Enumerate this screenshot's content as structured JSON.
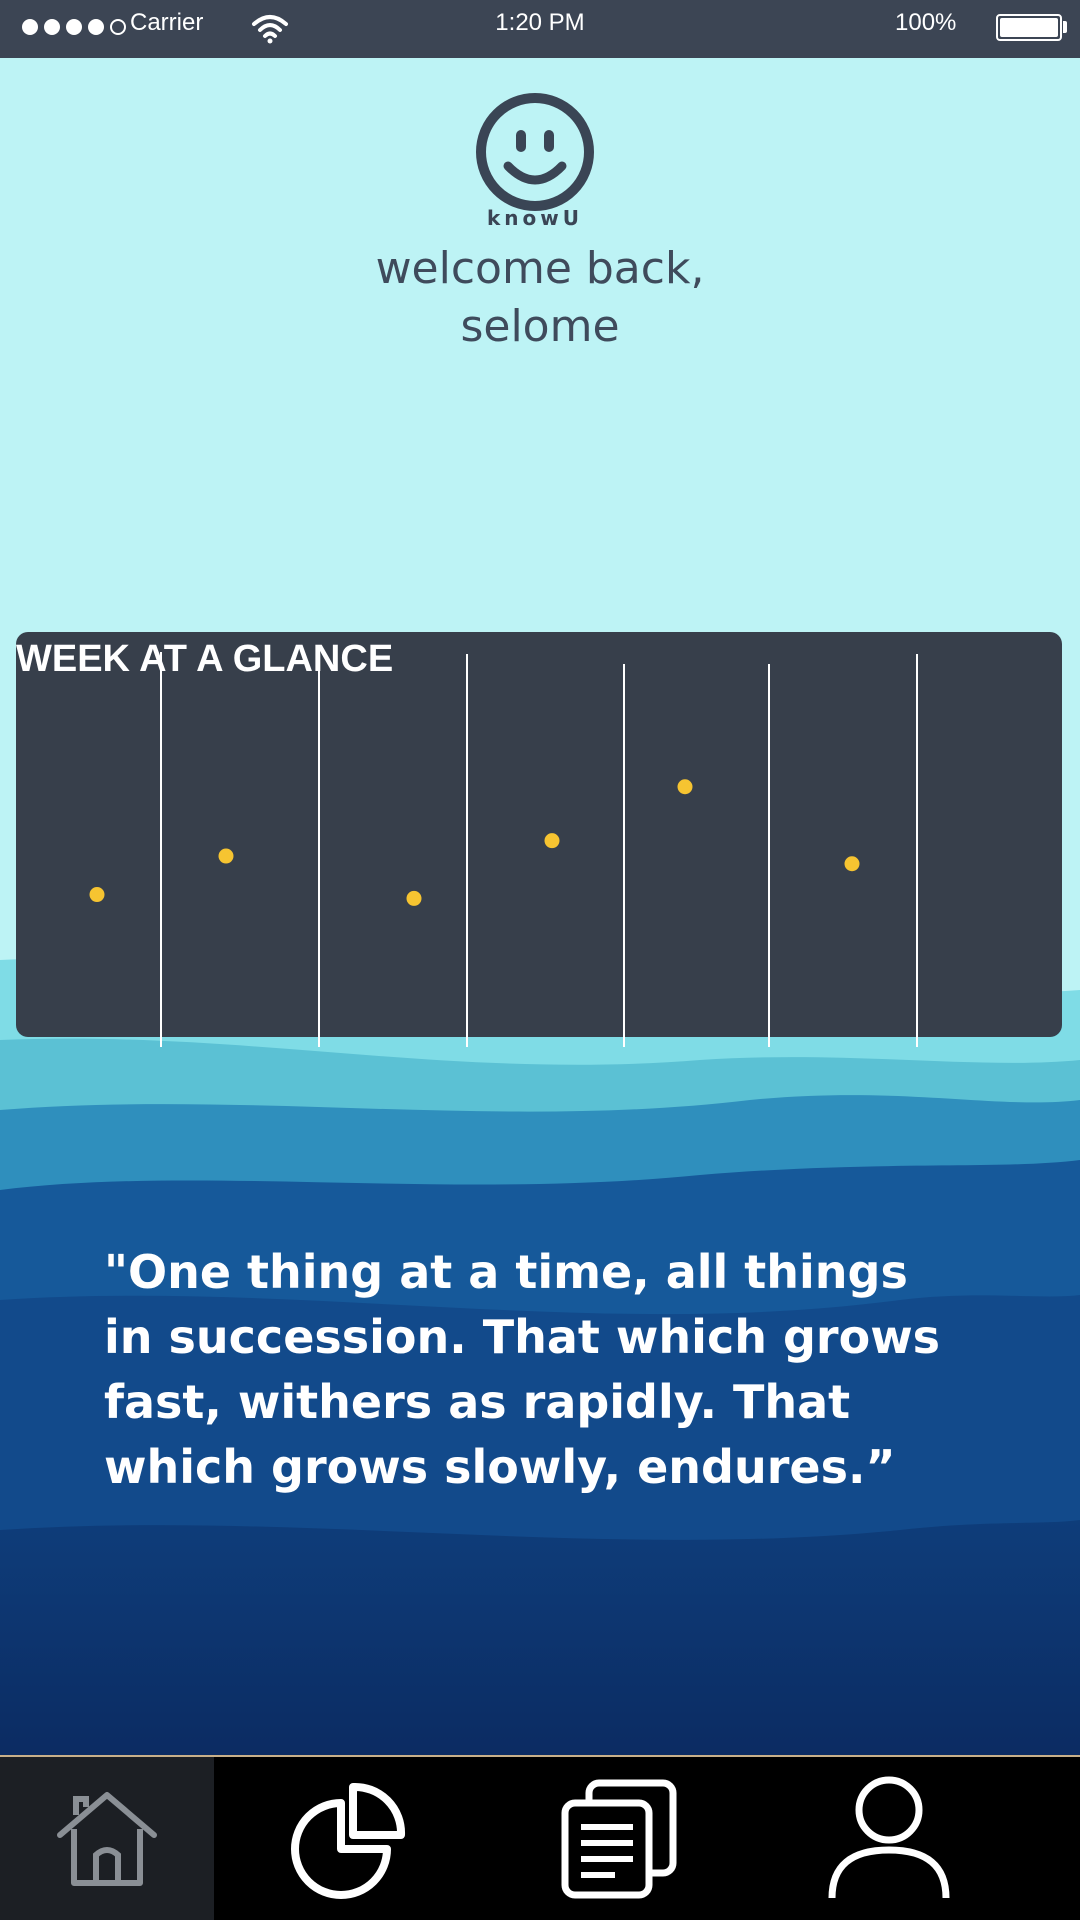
{
  "status_bar": {
    "carrier": "Carrier",
    "time": "1:20 PM",
    "battery": "100%",
    "signal_icon": "signal-dots-icon",
    "wifi_icon": "wifi-icon",
    "battery_icon": "battery-icon"
  },
  "header": {
    "logo_icon": "smiley-face-icon",
    "logo_text": "knowU",
    "welcome_line1": "welcome back,",
    "welcome_line2": "selome"
  },
  "week_card": {
    "title": "WEEK AT A GLANCE"
  },
  "chart_data": {
    "type": "scatter",
    "title": "WEEK AT A GLANCE",
    "categories": [
      "",
      "",
      "",
      "",
      "",
      "",
      ""
    ],
    "series": [
      {
        "values": [
          0.37,
          0.47,
          0.36,
          0.51,
          0.65,
          0.45
        ]
      }
    ],
    "grid": true,
    "point_color": "#f6c431",
    "line_color": "#ffffff"
  },
  "quote": {
    "text": "\"One thing at a time, all things in succession. That which grows fast, withers as rapidly. That which grows slowly, endures.”"
  },
  "tab_bar": {
    "tabs": [
      {
        "name": "home",
        "icon": "home-icon",
        "active": true
      },
      {
        "name": "stats",
        "icon": "pie-chart-icon",
        "active": false
      },
      {
        "name": "journal",
        "icon": "documents-icon",
        "active": false
      },
      {
        "name": "profile",
        "icon": "person-icon",
        "active": false
      }
    ]
  },
  "colors": {
    "sky": "#bdf3f5",
    "status_bar": "#3c4554",
    "card": "#373f4b",
    "accent_yellow": "#f6c431",
    "text_dark": "#3f4b5c"
  }
}
